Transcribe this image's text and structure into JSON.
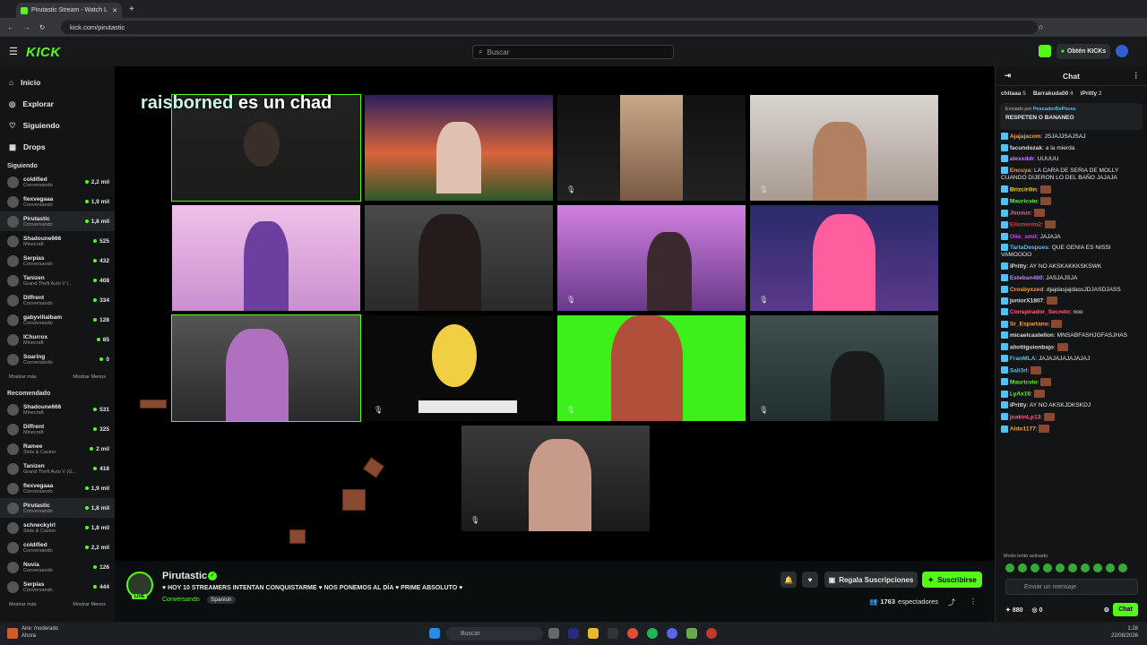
{
  "browser": {
    "tab_title": "Pirutastic Stream - Watch L",
    "url": "kick.com/pirutastic"
  },
  "header": {
    "logo": "KICK",
    "search_placeholder": "Buscar",
    "kicks_button": "Obtén KICKs"
  },
  "sidebar": {
    "nav": [
      "Inicio",
      "Explorar",
      "Siguiendo",
      "Drops"
    ],
    "following_title": "Siguiendo",
    "following": [
      {
        "name": "coldified",
        "category": "Conversando",
        "viewers": "2,2 mil"
      },
      {
        "name": "flexvegaaa",
        "category": "Conversando",
        "viewers": "1,9 mil"
      },
      {
        "name": "Pirutastic",
        "category": "Conversando",
        "viewers": "1,8 mil"
      },
      {
        "name": "Shadoune666",
        "category": "Minecraft",
        "viewers": "525"
      },
      {
        "name": "Serpias",
        "category": "Conversando",
        "viewers": "432"
      },
      {
        "name": "Tanizen",
        "category": "Grand Theft Auto V (...",
        "viewers": "408"
      },
      {
        "name": "Diffrent",
        "category": "Conversando",
        "viewers": "334"
      },
      {
        "name": "gabyvillalbam",
        "category": "Conversando",
        "viewers": "128"
      },
      {
        "name": "IChurrox",
        "category": "Minecraft",
        "viewers": "85"
      },
      {
        "name": "Soaring",
        "category": "Conversando",
        "viewers": "0"
      }
    ],
    "show_more": "Mostrar más",
    "show_less": "Mostrar Menos",
    "recommended_title": "Recomendado",
    "recommended": [
      {
        "name": "Shadoune666",
        "category": "Minecraft",
        "viewers": "531"
      },
      {
        "name": "Diffrent",
        "category": "Minecraft",
        "viewers": "325"
      },
      {
        "name": "Ramee",
        "category": "Slots & Casino",
        "viewers": "2 mil"
      },
      {
        "name": "Tanizen",
        "category": "Grand Theft Auto V (G...",
        "viewers": "418"
      },
      {
        "name": "flexvegaaa",
        "category": "Conversando",
        "viewers": "1,9 mil"
      },
      {
        "name": "Pirutastic",
        "category": "Conversando",
        "viewers": "1,8 mil"
      },
      {
        "name": "schneckyirl",
        "category": "Slots & Casino",
        "viewers": "1,8 mil"
      },
      {
        "name": "coldified",
        "category": "Conversando",
        "viewers": "2,2 mil"
      },
      {
        "name": "Nuvia",
        "category": "Conversando",
        "viewers": "126"
      },
      {
        "name": "Serpias",
        "category": "Conversando",
        "viewers": "444"
      }
    ]
  },
  "stream": {
    "overlay_name": "raisborned",
    "overlay_rest": "es un chad",
    "channel": "Pirutastic",
    "live_tag": "LIVE",
    "title": "♥ HOY 10 STREAMERS INTENTAN CONQUISTARME ♥ NOS PONEMOS AL DÍA ♥ PRIME ABSOLUTO ♥",
    "category": "Conversando",
    "language": "Spanish",
    "gift_button": "Regala Suscripciones",
    "subscribe_button": "Suscribirse",
    "viewers": "1763",
    "viewers_label": "espectadores"
  },
  "chat": {
    "title": "Chat",
    "gifters": [
      {
        "name": "chitaaa",
        "count": "5"
      },
      {
        "name": "Barrakuda00",
        "count": "4"
      },
      {
        "name": "iPritty",
        "count": "2"
      }
    ],
    "pinned_by_label": "Enviado por",
    "pinned_by": "PescadorDePeces",
    "pinned_text": "RESPETEN O BANANEO",
    "messages": [
      {
        "user": "Ajajajacom",
        "color": "#f5a142",
        "text": "JSJAJJSAJSAJ"
      },
      {
        "user": "facundozak",
        "color": "#dddddd",
        "text": "a la mierda"
      },
      {
        "user": "alexxddr",
        "color": "#c77dff",
        "text": "UUUUU"
      },
      {
        "user": "Encuya",
        "color": "#f5a142",
        "text": "LA CARA DE SERIA DE MOLLY CUANDO DIJERON LO DEL BAÑO JAJAJA"
      },
      {
        "user": "Brizcirilin",
        "color": "#f5d142",
        "text": ""
      },
      {
        "user": "Mauricvio",
        "color": "#53fc18",
        "text": ""
      },
      {
        "user": "Jousus",
        "color": "#ff5e7e",
        "text": ""
      },
      {
        "user": "Elismento2",
        "color": "#e53935",
        "text": ""
      },
      {
        "user": "Olio_smit",
        "color": "#e040fb",
        "text": "JAJAJA"
      },
      {
        "user": "TartaDespues",
        "color": "#4fc3f7",
        "text": "QUE GENIA ES NISSI VAMOOOO"
      },
      {
        "user": "iPritty",
        "color": "#dddddd",
        "text": "AY NO AKSKAKKKSKSWK"
      },
      {
        "user": "Esteban480",
        "color": "#c77dff",
        "text": "JASJAJSJA"
      },
      {
        "user": "Crosbyxzed",
        "color": "#f5a142",
        "text": "djajdasjajdassJDJASDJASS"
      },
      {
        "user": "juniorX1807",
        "color": "#dddddd",
        "text": ""
      },
      {
        "user": "Conspirador_Secreto",
        "color": "#ff5e7e",
        "text": "noo"
      },
      {
        "user": "Sr_Espartano",
        "color": "#f5a142",
        "text": ""
      },
      {
        "user": "micaelcastellon",
        "color": "#dddddd",
        "text": "MNSABFASHJGFASJHAS"
      },
      {
        "user": "aliottiguionbajo",
        "color": "#dddddd",
        "text": ""
      },
      {
        "user": "FranMLA",
        "color": "#4fc3f7",
        "text": "JAJAJAJAJAJAJAJ"
      },
      {
        "user": "Sali3rl",
        "color": "#4fc3f7",
        "text": ""
      },
      {
        "user": "Mauricvio",
        "color": "#53fc18",
        "text": ""
      },
      {
        "user": "LyAx16",
        "color": "#53fc18",
        "text": ""
      },
      {
        "user": "iPritty",
        "color": "#dddddd",
        "text": "AY NO AKSKJDKSKDJ"
      },
      {
        "user": "joakinLp13",
        "color": "#ff5e7e",
        "text": ""
      },
      {
        "user": "Aldo1177",
        "color": "#f5a142",
        "text": ""
      }
    ],
    "slow_mode": "Modo lento activado",
    "input_placeholder": "Enviar un mensaje",
    "kicks_count": "880",
    "points_count": "0",
    "send_button": "Chat"
  },
  "taskbar": {
    "weather": "Aire: moderado",
    "weather_sub": "Ahora",
    "search": "Buscar",
    "time": "1:28",
    "date": "22/08/2026"
  }
}
